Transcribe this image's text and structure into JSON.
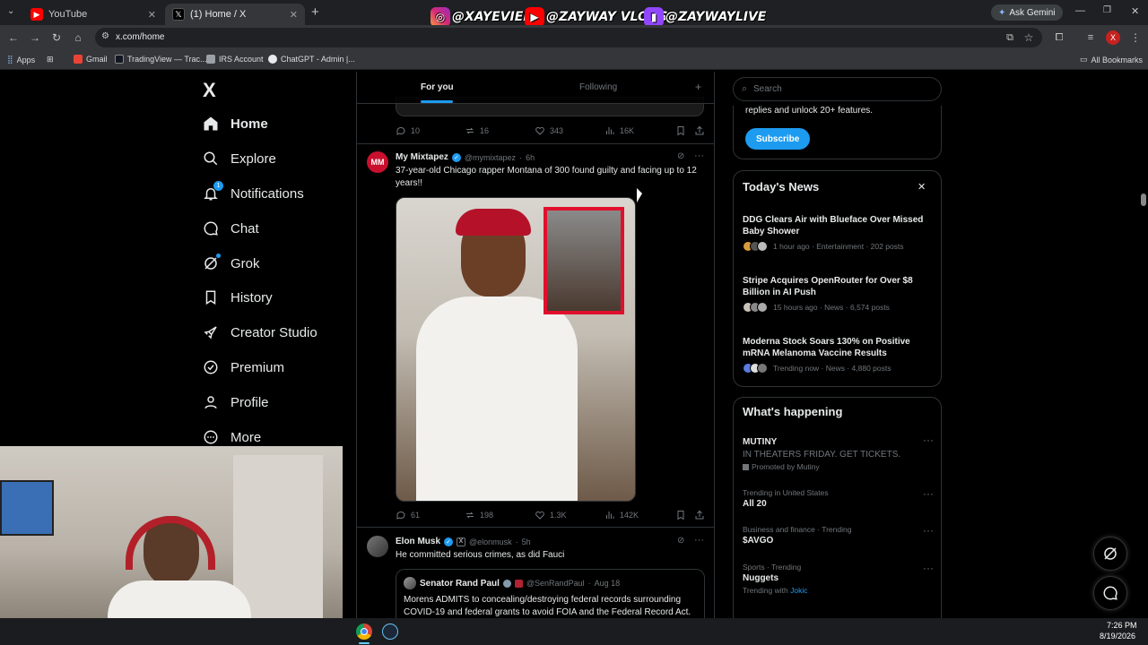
{
  "browser": {
    "tabs": [
      {
        "label": "YouTube",
        "active": false
      },
      {
        "label": "(1) Home / X",
        "active": true
      }
    ],
    "url": "x.com/home",
    "ask_gemini": "Ask Gemini",
    "profile_initial": "X",
    "bookmarks": [
      "Apps",
      "Gmail",
      "TradingView — Trac...",
      "IRS Account",
      "ChatGPT - Admin |..."
    ],
    "all_bookmarks": "All Bookmarks"
  },
  "overlay": {
    "instagram": "@XAYEVIER",
    "youtube": "@ZAYWAY VLOGS",
    "twitch": "@ZAYWAYLIVE"
  },
  "sidebar": {
    "logo": "X",
    "items": [
      {
        "label": "Home",
        "icon": "home-icon"
      },
      {
        "label": "Explore",
        "icon": "search-icon"
      },
      {
        "label": "Notifications",
        "icon": "bell-icon",
        "badge": "1"
      },
      {
        "label": "Chat",
        "icon": "chat-icon"
      },
      {
        "label": "Grok",
        "icon": "grok-icon"
      },
      {
        "label": "History",
        "icon": "bookmark-icon"
      },
      {
        "label": "Creator Studio",
        "icon": "rocket-icon"
      },
      {
        "label": "Premium",
        "icon": "verified-icon"
      },
      {
        "label": "Profile",
        "icon": "person-icon"
      },
      {
        "label": "More",
        "icon": "more-icon"
      }
    ]
  },
  "feed": {
    "tabs": [
      "For you",
      "Following"
    ],
    "top_post_metrics": {
      "replies": "10",
      "reposts": "16",
      "likes": "343",
      "views": "16K"
    },
    "post1": {
      "name": "My Mixtapez",
      "handle": "@mymixtapez",
      "time": "6h",
      "avatar_text": "MM",
      "text": "37-year-old Chicago rapper Montana of 300 found guilty and facing up to 12 years!!",
      "metrics": {
        "replies": "61",
        "reposts": "198",
        "likes": "1.3K",
        "views": "142K"
      }
    },
    "post2": {
      "name": "Elon Musk",
      "handle": "@elonmusk",
      "time": "5h",
      "text": "He committed serious crimes, as did Fauci",
      "quote": {
        "name": "Senator Rand Paul",
        "handle": "@SenRandPaul",
        "time": "Aug 18",
        "text": "Morens ADMITS to concealing/destroying federal records surrounding COVID-19 and federal grants to avoid FOIA and the Federal Record Act."
      }
    }
  },
  "right": {
    "search_placeholder": "Search",
    "premium_text": "replies and unlock 20+ features.",
    "subscribe": "Subscribe",
    "news_title": "Today's News",
    "news": [
      {
        "title": "DDG Clears Air with Blueface Over Missed Baby Shower",
        "meta": "1 hour ago · Entertainment · 202 posts"
      },
      {
        "title": "Stripe Acquires OpenRouter for Over $8 Billion in AI Push",
        "meta": "15 hours ago · News · 6,574 posts"
      },
      {
        "title": "Moderna Stock Soars 130% on Positive mRNA Melanoma Vaccine Results",
        "meta": "Trending now · News · 4,880 posts"
      }
    ],
    "happening_title": "What's happening",
    "trends": [
      {
        "category": "",
        "title": "MUTINY",
        "sub": "IN THEATERS FRIDAY. GET TICKETS.",
        "promo": "Promoted by Mutiny"
      },
      {
        "category": "Trending in United States",
        "title": "All 20"
      },
      {
        "category": "Business and finance · Trending",
        "title": "$AVGO"
      },
      {
        "category": "Sports · Trending",
        "title": "Nuggets",
        "with_label": "Trending with",
        "with_link": "Jokic"
      }
    ]
  },
  "taskbar": {
    "time": "7:26 PM",
    "date": "8/19/2026"
  },
  "colors": {
    "accent": "#1d9bf0",
    "bg": "#000000",
    "border": "#2f3336",
    "muted": "#71767b"
  }
}
